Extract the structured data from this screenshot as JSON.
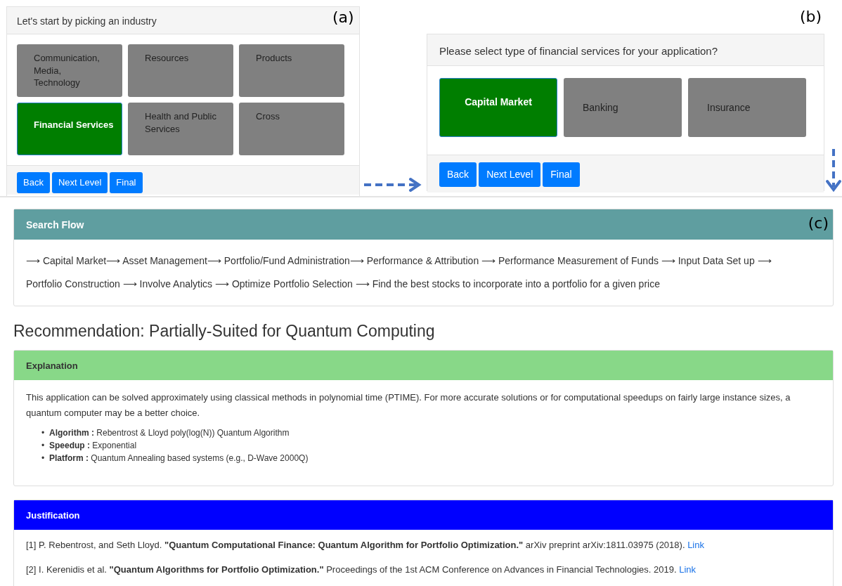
{
  "panel_a": {
    "label": "(a)",
    "title": "Let's start by picking an industry",
    "options": [
      {
        "label": "Communication,\nMedia,\nTechnology",
        "selected": false
      },
      {
        "label": "Resources",
        "selected": false
      },
      {
        "label": "Products",
        "selected": false
      },
      {
        "label": "Financial Services",
        "selected": true
      },
      {
        "label": "Health and Public\nServices",
        "selected": false
      },
      {
        "label": "Cross",
        "selected": false
      }
    ],
    "buttons": [
      "Back",
      "Next Level",
      "Final"
    ]
  },
  "panel_b": {
    "label": "(b)",
    "title": "Please select type of financial services for your application?",
    "options": [
      {
        "label": "Capital Market",
        "selected": true
      },
      {
        "label": "Banking",
        "selected": false
      },
      {
        "label": "Insurance",
        "selected": false
      }
    ],
    "buttons": [
      "Back",
      "Next Level",
      "Final"
    ]
  },
  "search_flow": {
    "label": "(c)",
    "title": "Search Flow",
    "text": "⟶ Capital Market⟶ Asset Management⟶ Portfolio/Fund Administration⟶ Performance & Attribution ⟶ Performance Measurement of Funds ⟶ Input Data Set up ⟶ Portfolio Construction ⟶ Involve Analytics ⟶ Optimize Portfolio Selection ⟶ Find the best stocks to incorporate into a portfolio for a given price"
  },
  "recommendation": "Recommendation: Partially-Suited for Quantum Computing",
  "explanation": {
    "title": "Explanation",
    "text": "This application can be solved approximately using classical methods in polynomial time (PTIME). For more accurate solutions or for computational speedups on fairly large instance sizes, a quantum computer may be a better choice.",
    "items": [
      {
        "bullet": "•",
        "text": "**Algorithm :** Rebentrost & Lloyd poly(log(N)) Quantum Algorithm"
      },
      {
        "bullet": "•",
        "text": "**Speedup :** Exponential"
      },
      {
        "bullet": "•",
        "text": "**Platform :** Quantum Annealing based systems (e.g., D-Wave 2000Q)"
      }
    ]
  },
  "justification": {
    "title": "Justification",
    "references": [
      {
        "text": "[1] P. Rebentrost, and Seth Lloyd. **\"Quantum Computational Finance: Quantum Algorithm for Portfolio Optimization.\"** arXiv preprint arXiv:1811.03975 (2018).",
        "link": "Link"
      },
      {
        "text": "[2] I. Kerenidis et al. **\"Quantum Algorithms for Portfolio Optimization.\"** Proceedings of the 1st ACM Conference on Advances in Financial Technologies. 2019.",
        "link": "Link"
      }
    ]
  }
}
